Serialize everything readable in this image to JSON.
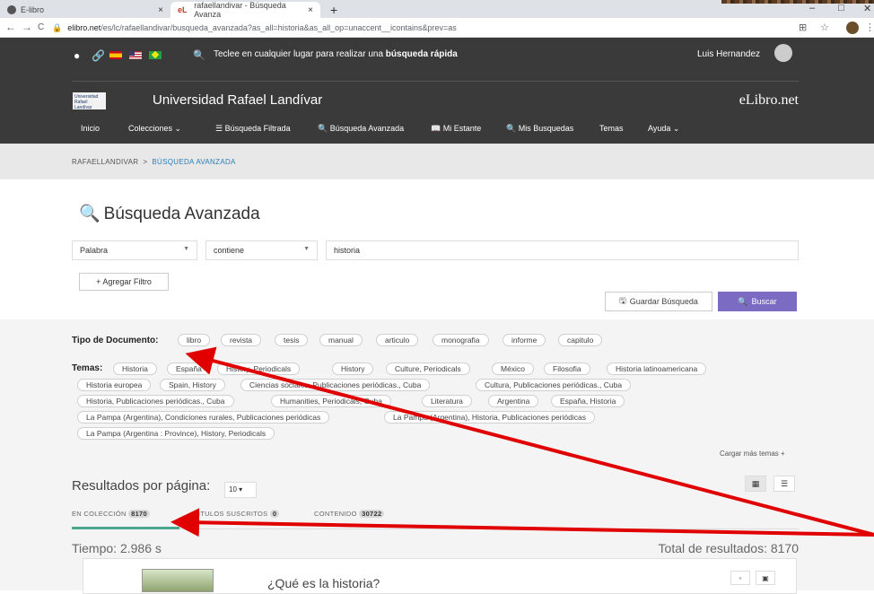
{
  "browser": {
    "tabs": [
      {
        "label": "E-libro",
        "close": "×",
        "active": false
      },
      {
        "label": "rafaellandivar - Búsqueda Avanza",
        "close": "×",
        "active": true,
        "favicon_text": "eL"
      }
    ],
    "new_tab": "+",
    "window_controls": [
      "–",
      "□",
      "✕"
    ],
    "nav": {
      "back": "←",
      "forward": "→",
      "reload": "C"
    },
    "url_domain": "elibro.net",
    "url_path": "/es/lc/rafaellandivar/busqueda_avanzada?as_all=historia&as_all_op=unaccent__icontains&prev=as"
  },
  "header": {
    "quick_search_prefix": "Teclee en cualquier lugar para realizar una",
    "quick_search_bold": "búsqueda rápida",
    "user_name": "Luis Hernandez",
    "university_logo_text": "Universidad Rafael Landívar",
    "university_name": "Universidad Rafael Landívar",
    "brand": "eLibro.net",
    "menu": [
      "Inicio",
      "Colecciones  ⌄",
      "☰ Búsqueda Filtrada",
      "🔍 Búsqueda Avanzada",
      "📖 Mi Estante",
      "🔍 Mis Busquedas",
      "Temas",
      "Ayuda  ⌄"
    ]
  },
  "breadcrumb": {
    "root": "RAFAELLANDIVAR",
    "sep": ">",
    "current": "BÚSQUEDA AVANZADA"
  },
  "search": {
    "title": "Búsqueda Avanzada",
    "field_select": "Palabra",
    "op_select": "contiene",
    "query": "historia",
    "add_filter": "+ Agregar Filtro",
    "save": "Guardar Búsqueda",
    "submit": "Buscar"
  },
  "filters": {
    "doc_type_label": "Tipo de Documento:",
    "doc_types": [
      "libro",
      "revista",
      "tesis",
      "manual",
      "articulo",
      "monografia",
      "informe",
      "capitulo"
    ],
    "temas_label": "Temas:",
    "temas": [
      "Historia",
      "España",
      "History, Periodicals",
      "History",
      "Culture, Periodicals",
      "México",
      "Filosofia",
      "Historia latinoamericana",
      "Historia europea",
      "Spain, History",
      "Ciencias sociales, Publicaciones periódicas., Cuba",
      "Cultura, Publicaciones periódicas., Cuba",
      "Historia, Publicaciones periódicas., Cuba",
      "Humanities, Periodicals, Cuba",
      "Literatura",
      "Argentina",
      "España, Historia",
      "La Pampa (Argentina), Condiciones rurales, Publicaciones periódicas",
      "La Pampa (Argentina), Historia, Publicaciones periódicas",
      "La Pampa (Argentina : Province), History, Periodicals"
    ],
    "more_temas": "Cargar más temas +"
  },
  "results": {
    "per_page_label": "Resultados por página:",
    "per_page_value": "10 ▾",
    "tabs": [
      {
        "label": "EN COLECCIÓN",
        "count": "8170"
      },
      {
        "label": "TITULOS SUSCRITOS",
        "count": "0"
      },
      {
        "label": "CONTENIDO",
        "count": "30722"
      }
    ],
    "time": "Tiempo: 2.986 s",
    "total": "Total de resultados: 8170",
    "first_title": "¿Qué es la historia?"
  },
  "colors": {
    "header_bg": "#3a3a3a",
    "accent_purple": "#7b6bc2",
    "tab_underline": "#4ba88e",
    "arrow_red": "#e00000"
  }
}
